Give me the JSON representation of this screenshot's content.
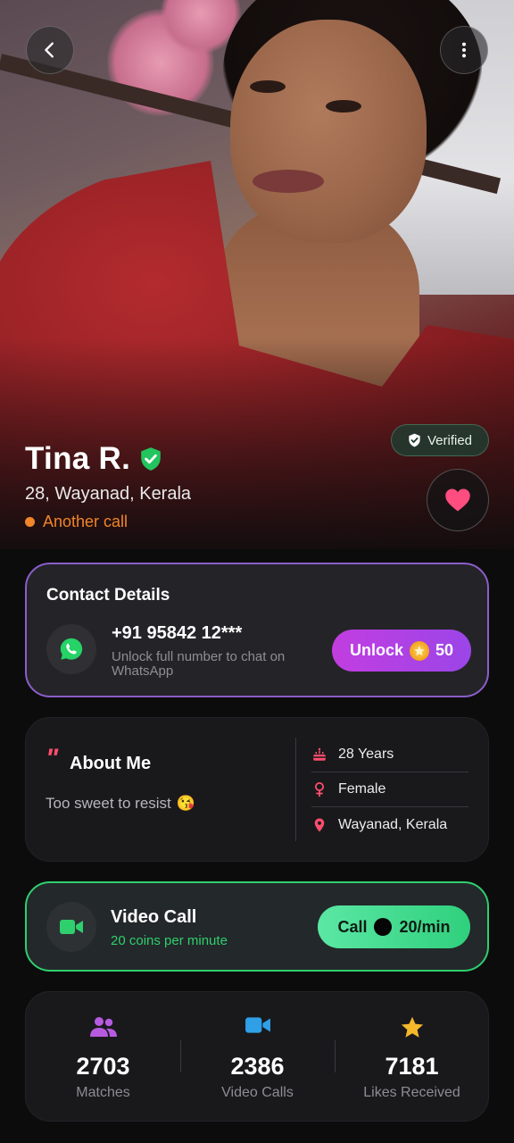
{
  "profile": {
    "name": "Tina R.",
    "meta": "28, Wayanad, Kerala",
    "status": "Another call",
    "verified_label": "Verified"
  },
  "contact": {
    "title": "Contact Details",
    "phone": "+91 95842 12***",
    "subtitle": "Unlock full number to chat on WhatsApp",
    "unlock_label": "Unlock",
    "unlock_cost": "50"
  },
  "about": {
    "quote_mark": "\"",
    "title": "About Me",
    "text": "Too sweet to resist",
    "emoji": "😘",
    "facts": [
      {
        "label": "28 Years",
        "icon": "cake-icon"
      },
      {
        "label": "Female",
        "icon": "female-icon"
      },
      {
        "label": "Wayanad, Kerala",
        "icon": "location-pin-icon"
      }
    ]
  },
  "video_call": {
    "title": "Video Call",
    "subtitle": "20 coins per minute",
    "call_label": "Call",
    "rate": "20/min"
  },
  "stats": [
    {
      "value": "2703",
      "label": "Matches",
      "icon": "people-icon"
    },
    {
      "value": "2386",
      "label": "Video Calls",
      "icon": "video-camera-icon"
    },
    {
      "value": "7181",
      "label": "Likes Received",
      "icon": "star-icon"
    }
  ],
  "colors": {
    "accent_purple": "#8b5ec9",
    "accent_green": "#2fcf6e",
    "status_orange": "#f0852b",
    "heart_pink": "#ff4d80"
  }
}
